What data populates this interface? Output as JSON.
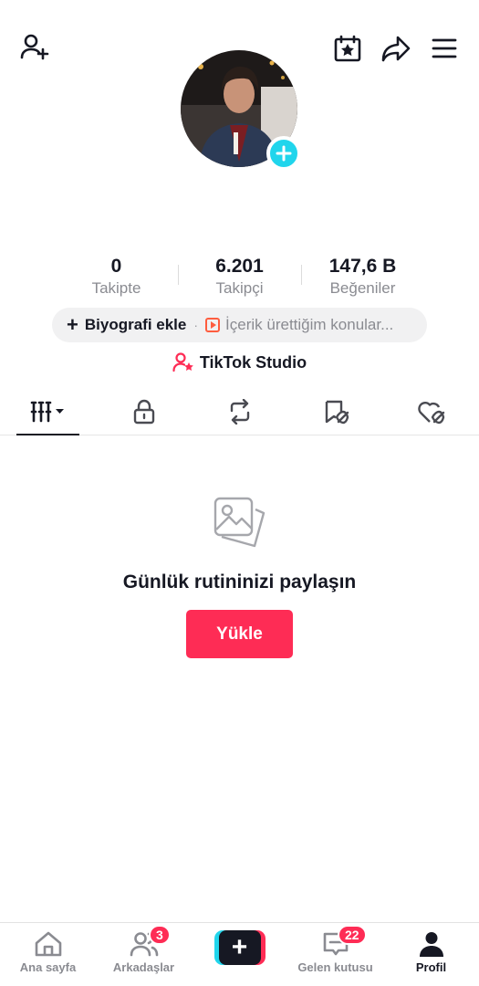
{
  "stats": [
    {
      "value": "0",
      "label": "Takipte"
    },
    {
      "value": "6.201",
      "label": "Takipçi"
    },
    {
      "value": "147,6 B",
      "label": "Beğeniler"
    }
  ],
  "bio": {
    "plus": "+",
    "add_label": "Biyografi ekle",
    "separator": "·",
    "topic_label": "İçerik ürettiğim konular..."
  },
  "studio": {
    "label": "TikTok Studio"
  },
  "empty_state": {
    "title": "Günlük rutininizi paylaşın",
    "upload_label": "Yükle"
  },
  "bottom_nav": {
    "home": "Ana sayfa",
    "friends": "Arkadaşlar",
    "friends_badge": "3",
    "create_symbol": "+",
    "inbox": "Gelen kutusu",
    "inbox_badge": "22",
    "profile": "Profil"
  },
  "colors": {
    "accent": "#fe2c55",
    "cyan": "#20d5ec",
    "text": "#161823",
    "muted": "#8a8b91"
  },
  "icons": [
    "add-friend-icon",
    "calendar-star-icon",
    "share-icon",
    "menu-icon",
    "grid-icon",
    "lock-icon",
    "repost-icon",
    "favorites-icon",
    "liked-icon",
    "gallery-icon",
    "home-icon",
    "friends-icon",
    "inbox-icon",
    "profile-icon"
  ]
}
